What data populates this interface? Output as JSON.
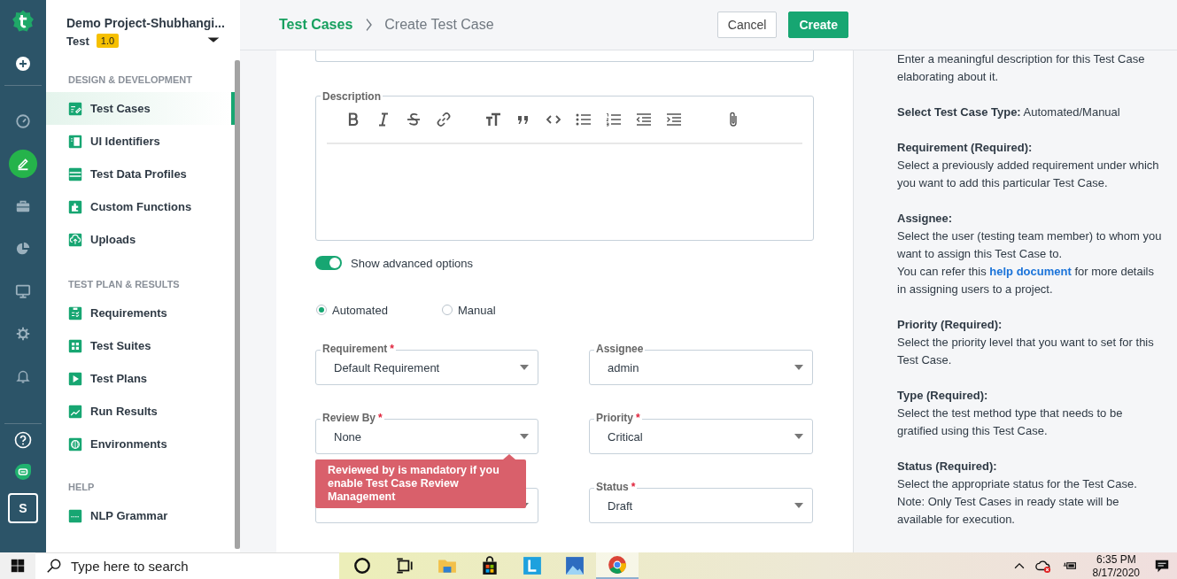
{
  "rail": {
    "avatar": "S",
    "items": [
      {
        "selected": false
      },
      {
        "selected": false
      },
      {
        "selected": true
      },
      {
        "selected": false
      },
      {
        "selected": false
      },
      {
        "selected": false
      },
      {
        "selected": false
      },
      {
        "selected": false
      },
      {
        "selected": false
      },
      {
        "selected": false
      }
    ]
  },
  "sidebar": {
    "project": "Demo Project-Shubhangi...",
    "version_label": "Test",
    "version": "1.0",
    "sections": [
      {
        "title": "DESIGN & DEVELOPMENT",
        "items": [
          {
            "label": "Test Cases",
            "selected": true
          },
          {
            "label": "UI Identifiers",
            "selected": false
          },
          {
            "label": "Test Data Profiles",
            "selected": false
          },
          {
            "label": "Custom Functions",
            "selected": false
          },
          {
            "label": "Uploads",
            "selected": false
          }
        ]
      },
      {
        "title": "TEST PLAN & RESULTS",
        "items": [
          {
            "label": "Requirements",
            "selected": false
          },
          {
            "label": "Test Suites",
            "selected": false
          },
          {
            "label": "Test Plans",
            "selected": false
          },
          {
            "label": "Run Results",
            "selected": false
          },
          {
            "label": "Environments",
            "selected": false
          }
        ]
      },
      {
        "title": "HELP",
        "items": [
          {
            "label": "NLP Grammar",
            "selected": false
          }
        ]
      }
    ]
  },
  "header": {
    "breadcrumb": [
      "Test Cases",
      "Create Test Case"
    ],
    "cancel": "Cancel",
    "create": "Create"
  },
  "form": {
    "description_label": "Description",
    "toggle": {
      "label": "Show advanced options",
      "on": true
    },
    "test_type": [
      {
        "label": "Automated",
        "selected": true
      },
      {
        "label": "Manual",
        "selected": false
      }
    ],
    "fields": [
      {
        "kind": "dropdown",
        "label": "Requirement",
        "required_mark": "*",
        "value": "Default Requirement"
      },
      {
        "kind": "dropdown",
        "label": "Assignee",
        "value": "admin"
      },
      {
        "kind": "dropdown",
        "label": "Review By",
        "required_mark": "*",
        "value": "None"
      },
      {
        "kind": "dropdown",
        "label": "Priority",
        "required_mark": "*",
        "value": "Critical"
      },
      {
        "kind": "covered"
      },
      {
        "kind": "dropdown",
        "label": "Status",
        "required_mark": "*",
        "value": "Draft"
      }
    ],
    "tooltip": "Reviewed by is mandatory if you enable Test Case Review Management"
  },
  "help": {
    "sections": [
      {
        "lines": [
          {
            "text": "Enter a meaningful description for this Test Case elaborating about it."
          }
        ]
      },
      {
        "lines": [
          {
            "text": "**Select Test Case Type:** Automated/Manual"
          }
        ]
      },
      {
        "heading": "Requirement (Required):",
        "lines": [
          {
            "text": "Select a previously added requirement under which you want to add this particular Test Case."
          }
        ]
      },
      {
        "heading": "Assignee:",
        "lines": [
          {
            "text": "Select the user (testing team member) to whom you want to assign this Test Case to."
          },
          {
            "text": "You can refer this",
            "link": "help document",
            "after": "for more details in assigning users to a project."
          }
        ]
      },
      {
        "heading": "Priority (Required):",
        "lines": [
          {
            "text": "Select the priority level that you want to set for this Test Case."
          }
        ]
      },
      {
        "heading": "Type (Required):",
        "lines": [
          {
            "text": "Select the test method type that needs to be gratified using this Test Case."
          }
        ]
      },
      {
        "heading": "Status (Required):",
        "lines": [
          {
            "text": "Select the appropriate status for the Test Case."
          },
          {
            "text": "Note: Only Test Cases in ready state will be available for execution."
          }
        ]
      }
    ]
  },
  "taskbar": {
    "search": {
      "placeholder": "Type here to search"
    },
    "apps": [
      {
        "selected": false
      },
      {
        "selected": false
      },
      {
        "selected": false
      },
      {
        "selected": false
      },
      {
        "selected": false
      },
      {
        "selected": false
      },
      {
        "selected": true
      }
    ],
    "time": "6:35 PM",
    "date": "8/17/2020"
  }
}
